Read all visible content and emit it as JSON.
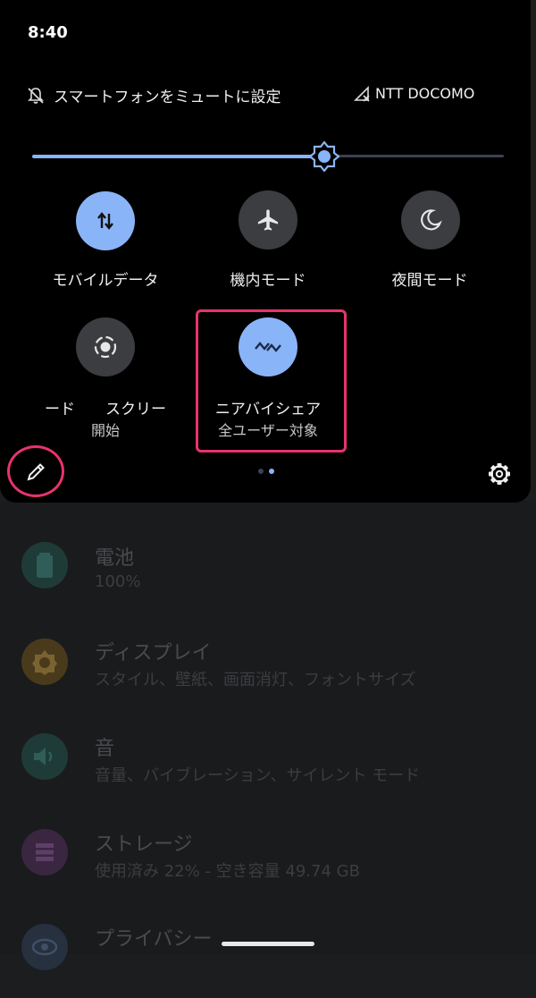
{
  "status_bar": {
    "time": "8:40"
  },
  "quick_settings": {
    "mute_label": "スマートフォンをミュートに設定",
    "carrier": "NTT DOCOMO",
    "brightness_level": 0.62,
    "tiles": [
      {
        "label": "モバイルデータ",
        "icon": "mobile-data-icon",
        "state": "on"
      },
      {
        "label": "機内モード",
        "icon": "airplane-icon",
        "state": "off"
      },
      {
        "label": "夜間モード",
        "icon": "moon-icon",
        "state": "off"
      },
      {
        "label": "ード　　スクリー",
        "sub": "開始",
        "icon": "screen-record-icon",
        "state": "off"
      },
      {
        "label": "ニアバイシェア",
        "sub": "全ユーザー対象",
        "icon": "nearby-share-icon",
        "state": "on"
      }
    ],
    "page_indicator": {
      "pages": 2,
      "current": 2
    }
  },
  "settings_list": [
    {
      "title": "電池",
      "subtitle": "100%",
      "icon": "battery-icon",
      "color": "#1e3b38"
    },
    {
      "title": "ディスプレイ",
      "subtitle": "スタイル、壁紙、画面消灯、フォントサイズ",
      "icon": "display-icon",
      "color": "#4a3a1c"
    },
    {
      "title": "音",
      "subtitle": "音量、バイブレーション、サイレント モード",
      "icon": "sound-icon",
      "color": "#1e3b38"
    },
    {
      "title": "ストレージ",
      "subtitle": "使用済み 22% - 空き容量 49.74 GB",
      "icon": "storage-icon",
      "color": "#3a2640"
    },
    {
      "title": "プライバシー",
      "subtitle": "",
      "icon": "privacy-icon",
      "color": "#26303e"
    }
  ],
  "colors": {
    "accent": "#8ab4f8",
    "highlight": "#e8336b"
  }
}
